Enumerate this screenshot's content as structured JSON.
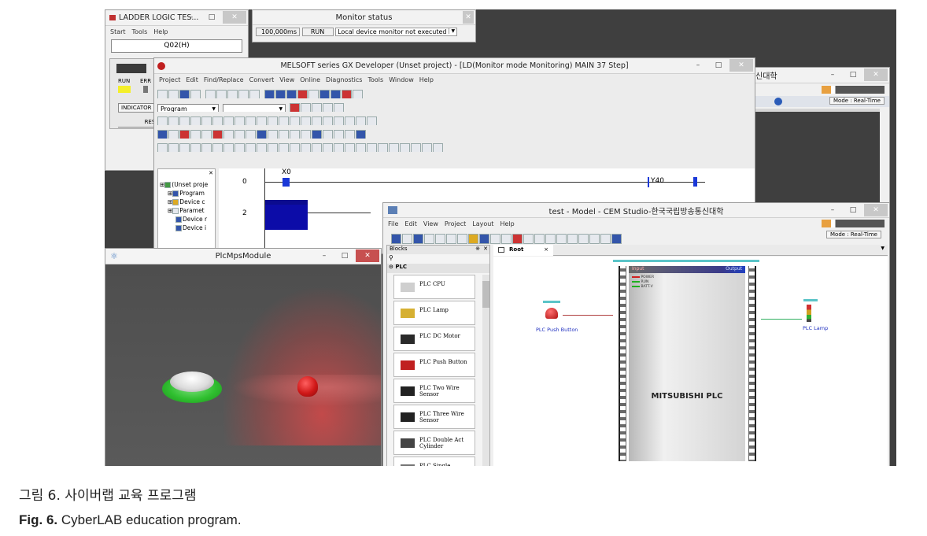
{
  "ladder_window": {
    "title": "LADDER LOGIC TES...",
    "menu": [
      "Start",
      "Tools",
      "Help"
    ],
    "cpu": "Q02(H)",
    "run_label": "RUN",
    "err_label": "ERR",
    "indicator_label": "INDICATOR",
    "reset_label": "RESET"
  },
  "monitor_window": {
    "title": "Monitor status",
    "scan_time": "100,000ms",
    "run_state": "RUN",
    "device_status": "Local device monitor not executed"
  },
  "gx_window": {
    "title": "MELSOFT series GX Developer (Unset project) - [LD(Monitor mode Monitoring)     MAIN    37 Step]",
    "menu": [
      "Project",
      "Edit",
      "Find/Replace",
      "Convert",
      "View",
      "Online",
      "Diagnostics",
      "Tools",
      "Window",
      "Help"
    ],
    "program_select": "Program",
    "tree": [
      "(Unset proje",
      "Program",
      "Device c",
      "Paramet",
      "Device r",
      "Device i"
    ],
    "rung0_step": "0",
    "rung0_contact": "X0",
    "rung0_coil": "Y40",
    "rung2_step": "2"
  },
  "cem_back_window": {
    "title_fragment": "신대학",
    "mode": "Mode : Real-Time"
  },
  "cem_window": {
    "title": "test - Model - CEM Studio-한국국립방송통신대학",
    "menu": [
      "File",
      "Edit",
      "View",
      "Project",
      "Layout",
      "Help"
    ],
    "mode": "Mode : Real-Time",
    "blocks_title": "Blocks",
    "blocks_group": "PLC",
    "blocks": [
      "PLC CPU",
      "PLC Lamp",
      "PLC DC Motor",
      "PLC Push Button",
      "PLC Two Wire Sensor",
      "PLC Three Wire Sensor",
      "PLC Double Act Cylinder",
      "PLC Single"
    ],
    "tab_label": "Root",
    "plc_input_label": "Input",
    "plc_output_label": "Output",
    "plc_status": [
      "POWER",
      "RUN",
      "BATT.V"
    ],
    "plc_name": "MITSUBISHI PLC",
    "push_button_label": "PLC Push Button",
    "lamp_label": "PLC Lamp"
  },
  "mps_window": {
    "title": "PlcMpsModule"
  },
  "caption_kr": "그림 6. 사이버랩 교육 프로그램",
  "caption_en_prefix": "Fig. 6.",
  "caption_en_text": "CyberLAB education program."
}
